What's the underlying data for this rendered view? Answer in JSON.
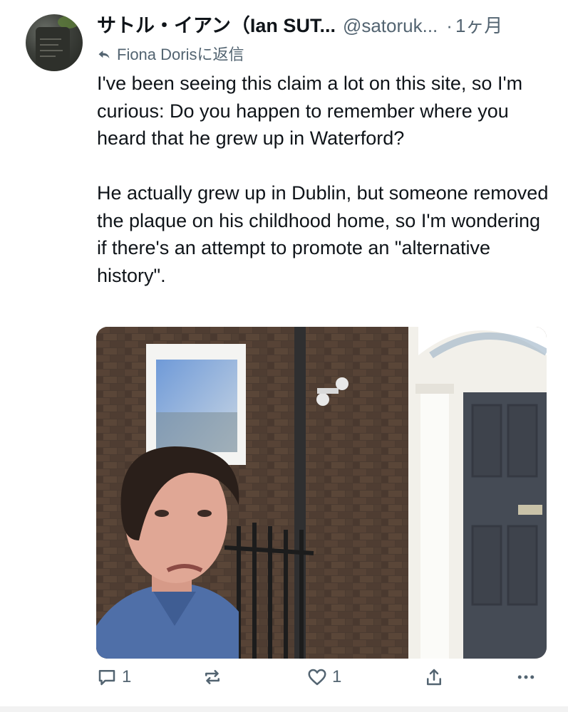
{
  "post": {
    "author_name": "サトル・イアン（Ian SUT...",
    "handle": "@satoruk...",
    "separator": "·",
    "time": "1ヶ月",
    "reply_to": "Fiona Dorisに返信",
    "paragraphs": [
      "I've been seeing this claim a lot on this site, so I'm curious: Do you happen to remember where you heard that he grew up in Waterford?",
      "He actually grew up in Dublin, but someone removed the plaque on his childhood home, so I'm wondering if there's an attempt to promote an \"alternative history\"."
    ]
  },
  "actions": {
    "reply": {
      "icon": "reply-icon",
      "count": "1"
    },
    "retweet": {
      "icon": "retweet-icon",
      "count": ""
    },
    "like": {
      "icon": "heart-icon",
      "count": "1"
    },
    "share": {
      "icon": "share-icon",
      "count": ""
    },
    "more": {
      "icon": "more-dots-icon"
    }
  },
  "colors": {
    "text": "#0f1419",
    "secondary": "#536471"
  }
}
